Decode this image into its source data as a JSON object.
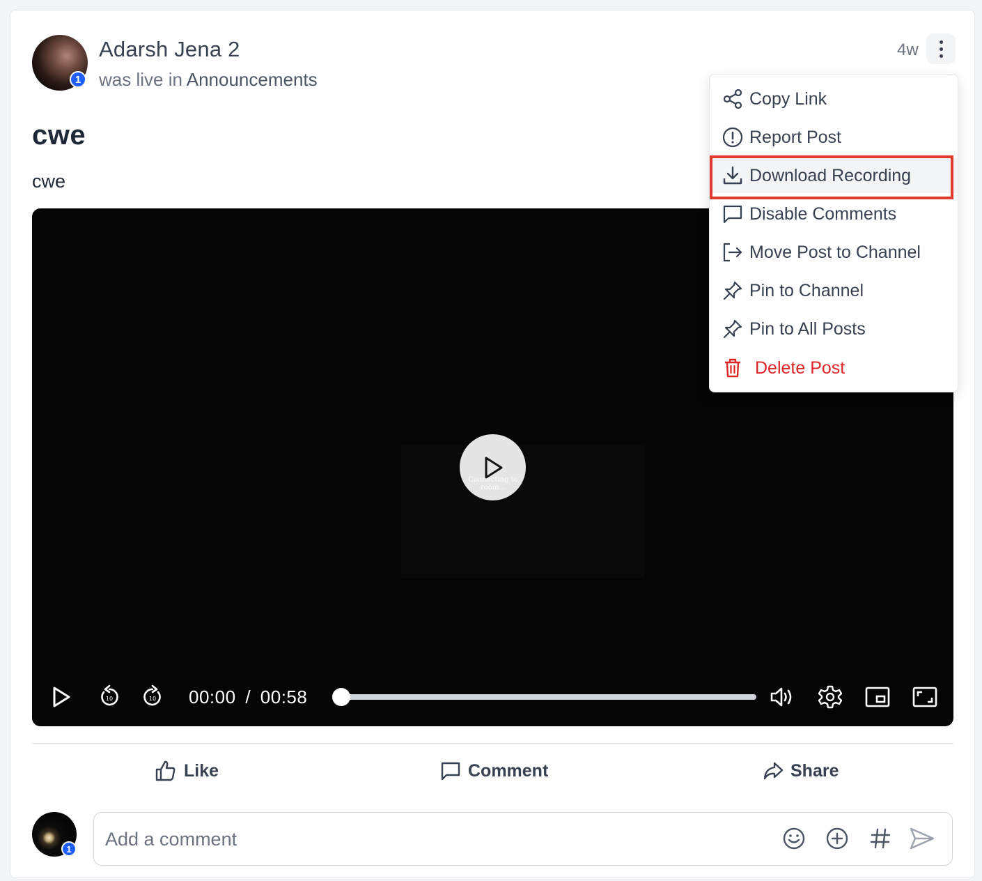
{
  "post": {
    "author": "Adarsh Jena 2",
    "action_text": "was live in",
    "channel": "Announcements",
    "time_ago": "4w",
    "badge_count": "1",
    "title": "cwe",
    "body": "cwe"
  },
  "video": {
    "overlay_text": "Connecting to room...",
    "current_time": "00:00",
    "separator": "/",
    "duration": "00:58",
    "progress_fraction": 0.0
  },
  "menu": {
    "items": [
      {
        "label": "Copy Link",
        "icon": "share-nodes-icon"
      },
      {
        "label": "Report Post",
        "icon": "alert-circle-icon"
      },
      {
        "label": "Download Recording",
        "icon": "download-icon"
      },
      {
        "label": "Disable Comments",
        "icon": "comment-icon"
      },
      {
        "label": "Move Post to Channel",
        "icon": "move-arrow-icon"
      },
      {
        "label": "Pin to Channel",
        "icon": "pin-icon"
      },
      {
        "label": "Pin to All Posts",
        "icon": "pin-icon"
      },
      {
        "label": "Delete Post",
        "icon": "trash-icon"
      }
    ],
    "danger_color": "#dc2626",
    "highlight_color": "#e23b2e"
  },
  "actions": {
    "like": "Like",
    "comment": "Comment",
    "share": "Share"
  },
  "composer": {
    "placeholder": "Add a comment",
    "badge_count": "1"
  },
  "colors": {
    "badge": "#1e5eff",
    "text_primary": "#1f2937",
    "text_muted": "#6b7280"
  }
}
